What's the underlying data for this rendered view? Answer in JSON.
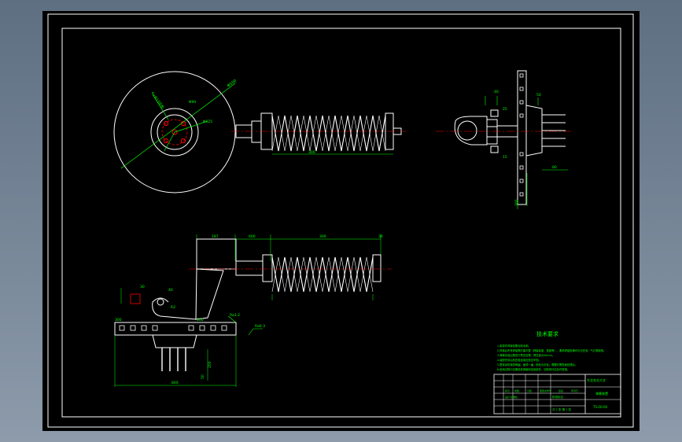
{
  "theme": {
    "canvas": "#000000",
    "frame": "#ffffff",
    "part": "#ffffff",
    "dimension": "#00ff00",
    "hole": "#ff0000",
    "text": "#00ff00"
  },
  "dims": {
    "disc_dia": "Φ500",
    "disc_note": "4×Φ13均布",
    "bolt_circle": "Φ125",
    "hub_dia": "Φ90",
    "spring_len": "300",
    "side_top": "40",
    "side_h1": "25",
    "side_h2": "15",
    "side_w1": "50",
    "side_w2": "80",
    "side_total": "300",
    "len_a": "187",
    "len_b": "600",
    "len_c": "300",
    "len_d": "30",
    "small_a": "30",
    "small_b": "40",
    "angle_label": "R2",
    "base_h": "100",
    "base_len": "840",
    "vert_a": "50",
    "vert_b": "200",
    "ra1": "Ra3.2",
    "ra2": "Ra6.3",
    "base_left": "300"
  },
  "tech": {
    "title": "技术要求",
    "notes": [
      "1.各零件焊接前需去除毛刺。",
      "2.焊接后所有焊缝需打磨平整（焊缝高度，宽度等）。要求焊缝饱满均匀无夹渣、气孔等缺陷。",
      "3.弹簧安装后需进行预压处理，预压量为20mm。",
      "4.装配完成后检查各连接处是否牢固。",
      "5.整体涂防锈漆两遍，面漆一遍，颜色为灰色；需要时需表面处理后。",
      "6.使用过程中定期检查弹簧和连接部件，如有损坏应及时更换。"
    ]
  },
  "title_block": {
    "school": "东北农业大学",
    "drawing_name": "弹簧装置",
    "drawing_no": "TS-00-00",
    "scale_row": "共 1 张  第 1 张",
    "rows": [
      "标记",
      "处数",
      "分区",
      "更改文件号",
      "签名",
      "年月日"
    ],
    "row2": "设计   标准化",
    "mid_label": "阶段标记"
  }
}
